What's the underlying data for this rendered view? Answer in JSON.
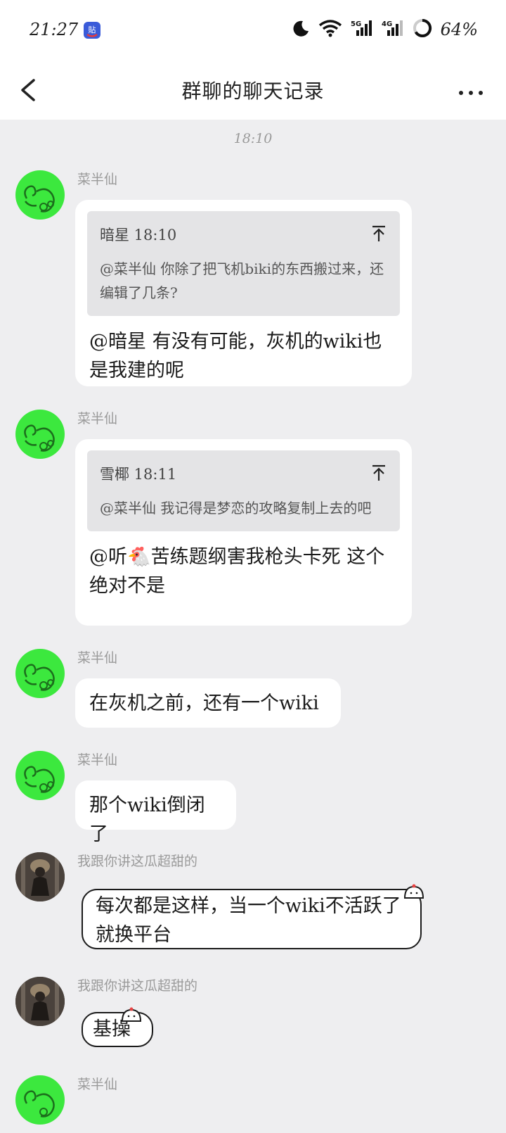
{
  "status_bar": {
    "time": "21:27",
    "app_icon": "tieba-icon",
    "network": [
      "5G",
      "4G"
    ],
    "battery": "64%"
  },
  "nav": {
    "title": "群聊的聊天记录",
    "back_icon": "chevron-left-icon",
    "more_icon": "more-dots-icon"
  },
  "timestamp": "18:10",
  "messages": [
    {
      "sender": "菜半仙",
      "quote": {
        "head": "暗星 18:10",
        "text": "@菜半仙 你除了把飞机biki的东西搬过来，还编辑了几条?"
      },
      "text": "@暗星 有没有可能，灰机的wiki也是我建的呢"
    },
    {
      "sender": "菜半仙",
      "quote": {
        "head": "雪椰 18:11",
        "text": "@菜半仙 我记得是梦恋的攻略复制上去的吧"
      },
      "text": "@听🐔苦练题纲害我枪头卡死 这个绝对不是"
    },
    {
      "sender": "菜半仙",
      "text": "在灰机之前，还有一个wiki"
    },
    {
      "sender": "菜半仙",
      "text": "那个wiki倒闭了"
    },
    {
      "sender": "我跟你讲这瓜超甜的",
      "text": "每次都是这样，当一个wiki不活跃了就换平台"
    },
    {
      "sender": "我跟你讲这瓜超甜的",
      "text": "基操"
    },
    {
      "sender": "菜半仙"
    }
  ],
  "colors": {
    "background": "#eeeef0",
    "bubble": "#ffffff",
    "quote_bg": "#e4e4e6",
    "avatar_green": "#3ce83e"
  }
}
